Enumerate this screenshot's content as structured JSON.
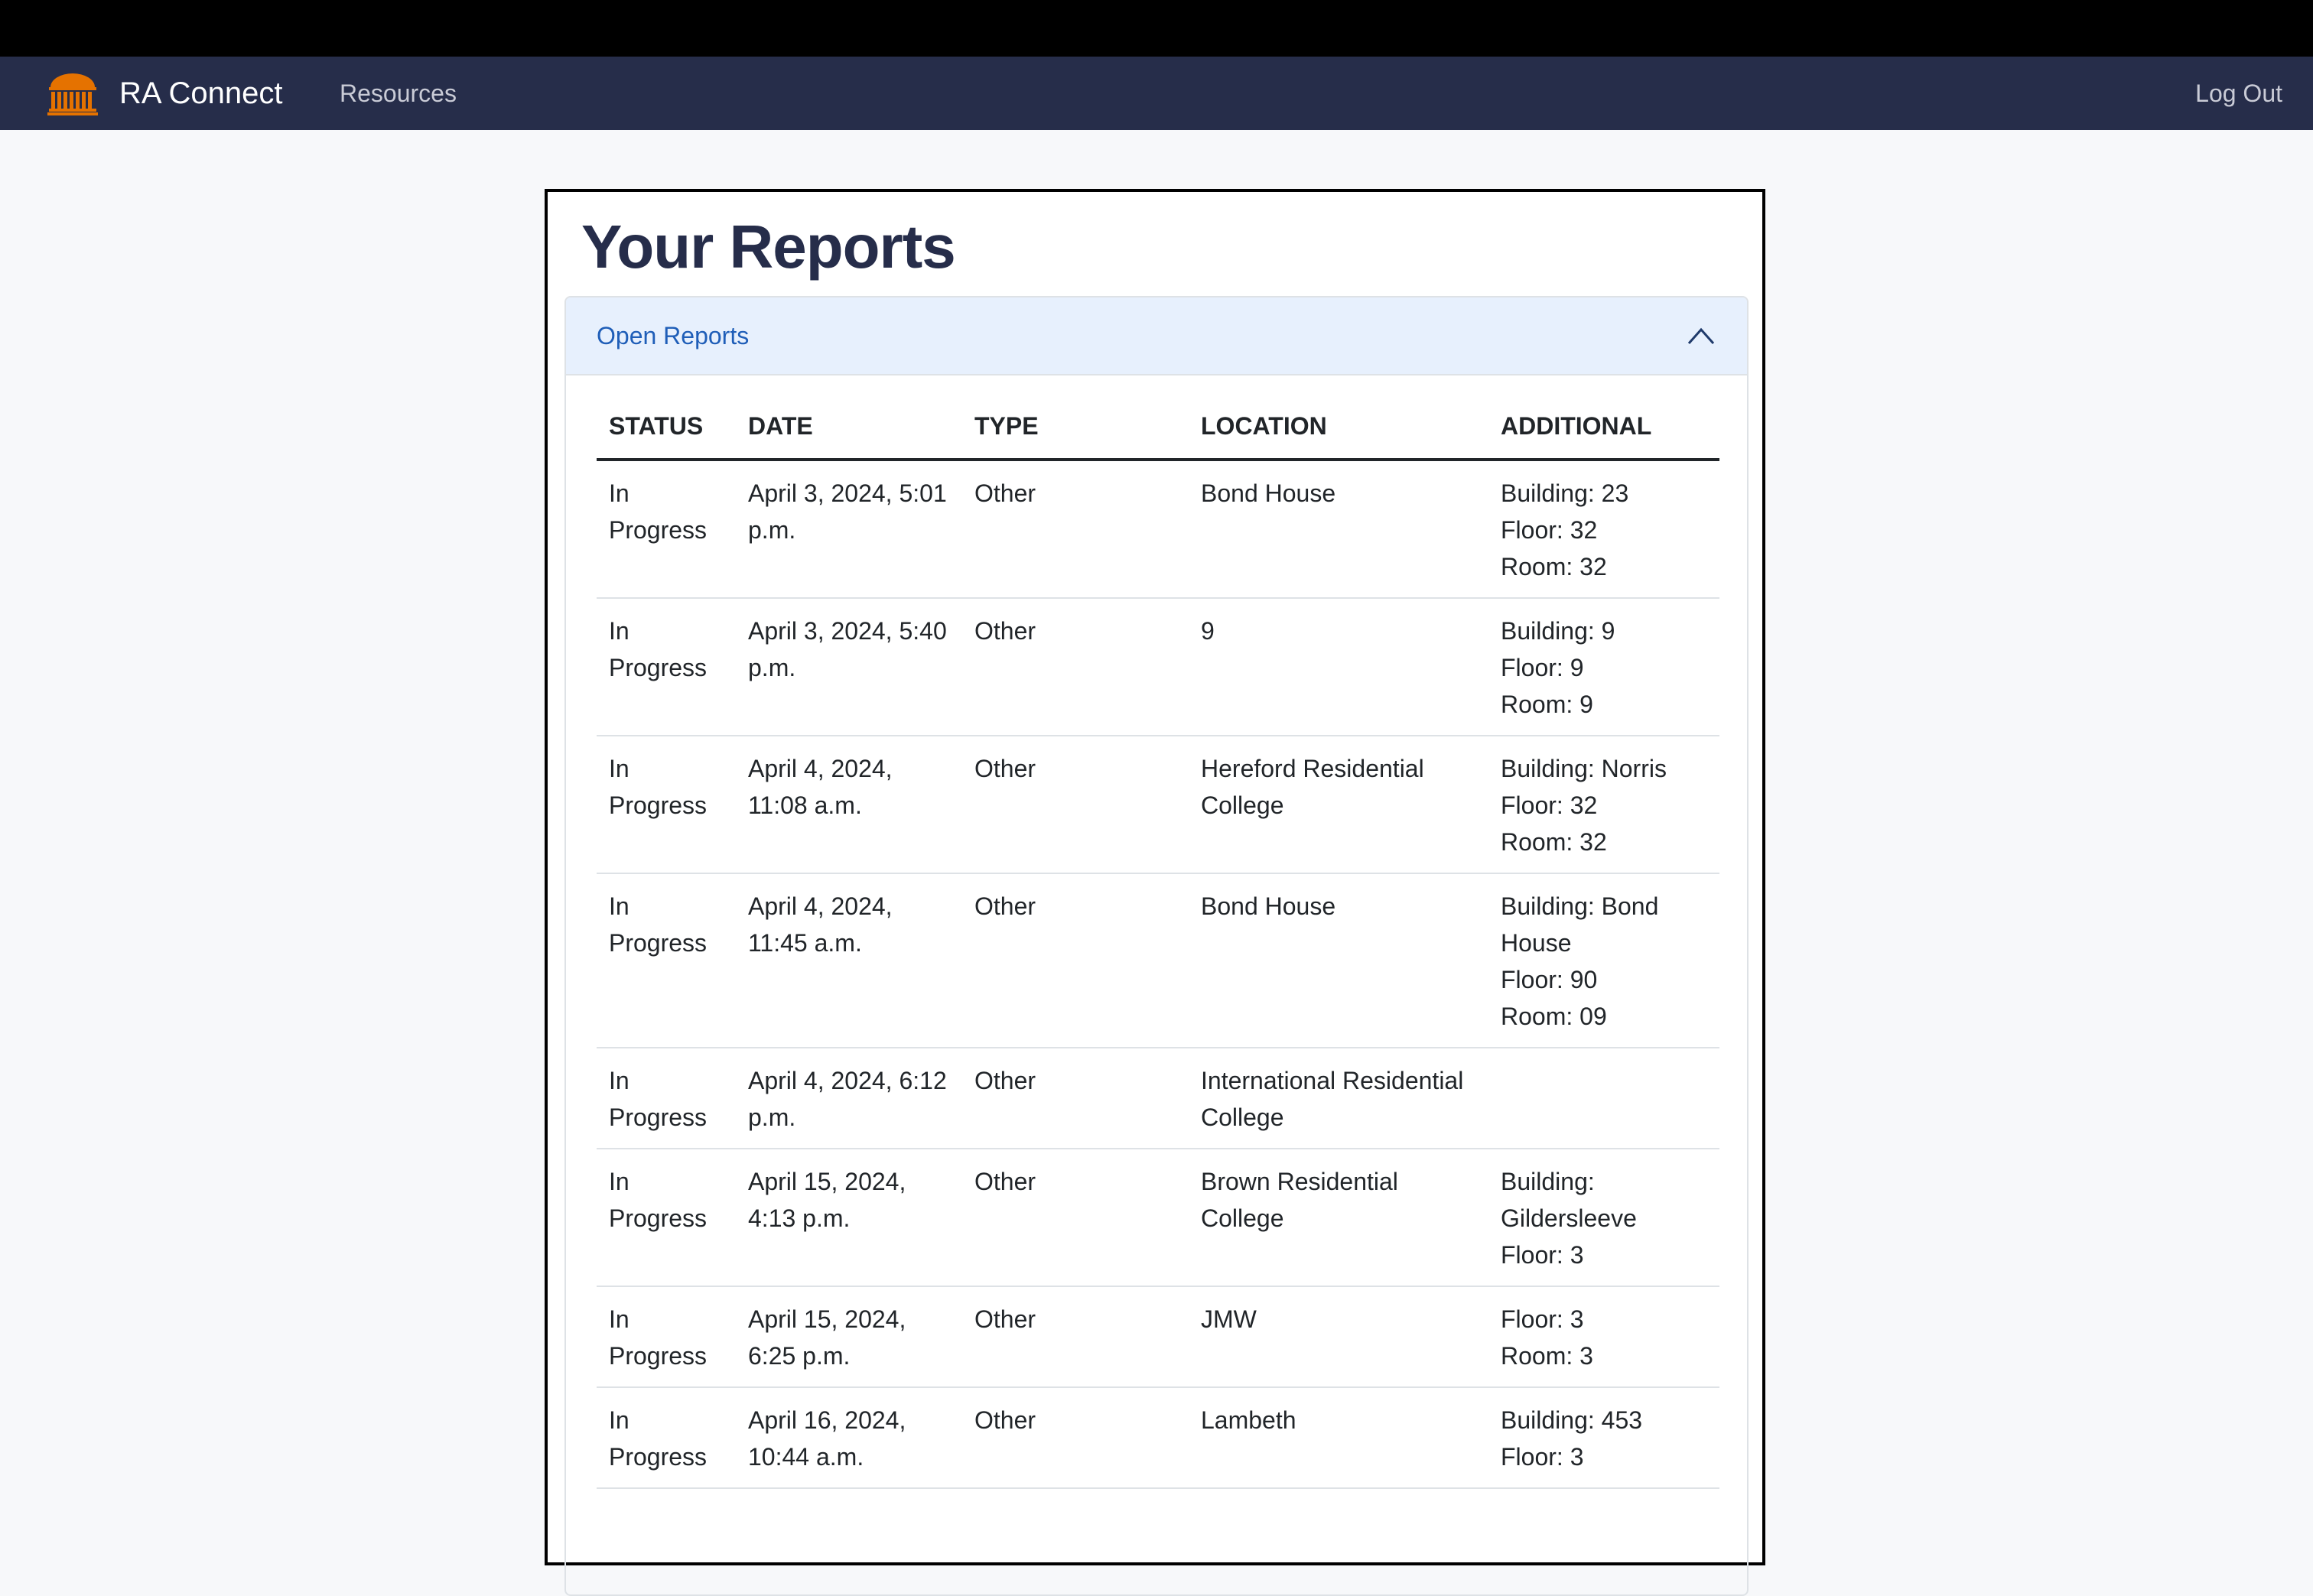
{
  "nav": {
    "brand": "RA Connect",
    "resources": "Resources",
    "logout": "Log Out",
    "logo_icon": "rotunda-logo-icon",
    "colors": {
      "bar": "#262d4a",
      "logo": "#e57200"
    }
  },
  "page": {
    "title": "Your Reports"
  },
  "accordion": {
    "title": "Open Reports",
    "chevron_icon": "chevron-up-icon"
  },
  "table": {
    "headers": [
      "STATUS",
      "DATE",
      "TYPE",
      "LOCATION",
      "ADDITIONAL"
    ],
    "rows": [
      {
        "status": "In Progress",
        "date": "April 3, 2024, 5:01 p.m.",
        "type": "Other",
        "location": "Bond House",
        "additional": [
          "Building: 23",
          "Floor: 32",
          "Room: 32"
        ]
      },
      {
        "status": "In Progress",
        "date": "April 3, 2024, 5:40 p.m.",
        "type": "Other",
        "location": "9",
        "additional": [
          "Building: 9",
          "Floor: 9",
          "Room: 9"
        ]
      },
      {
        "status": "In Progress",
        "date": "April 4, 2024, 11:08 a.m.",
        "type": "Other",
        "location": "Hereford Residential College",
        "additional": [
          "Building: Norris",
          "Floor: 32",
          "Room: 32"
        ]
      },
      {
        "status": "In Progress",
        "date": "April 4, 2024, 11:45 a.m.",
        "type": "Other",
        "location": "Bond House",
        "additional": [
          "Building: Bond House",
          "Floor: 90",
          "Room: 09"
        ]
      },
      {
        "status": "In Progress",
        "date": "April 4, 2024, 6:12 p.m.",
        "type": "Other",
        "location": "International Residential College",
        "additional": []
      },
      {
        "status": "In Progress",
        "date": "April 15, 2024, 4:13 p.m.",
        "type": "Other",
        "location": "Brown Residential College",
        "additional": [
          "Building: Gildersleeve",
          "Floor: 3"
        ]
      },
      {
        "status": "In Progress",
        "date": "April 15, 2024, 6:25 p.m.",
        "type": "Other",
        "location": "JMW",
        "additional": [
          "Floor: 3",
          "Room: 3"
        ]
      },
      {
        "status": "In Progress",
        "date": "April 16, 2024, 10:44 a.m.",
        "type": "Other",
        "location": "Lambeth",
        "additional": [
          "Building: 453",
          "Floor: 3"
        ]
      }
    ]
  }
}
